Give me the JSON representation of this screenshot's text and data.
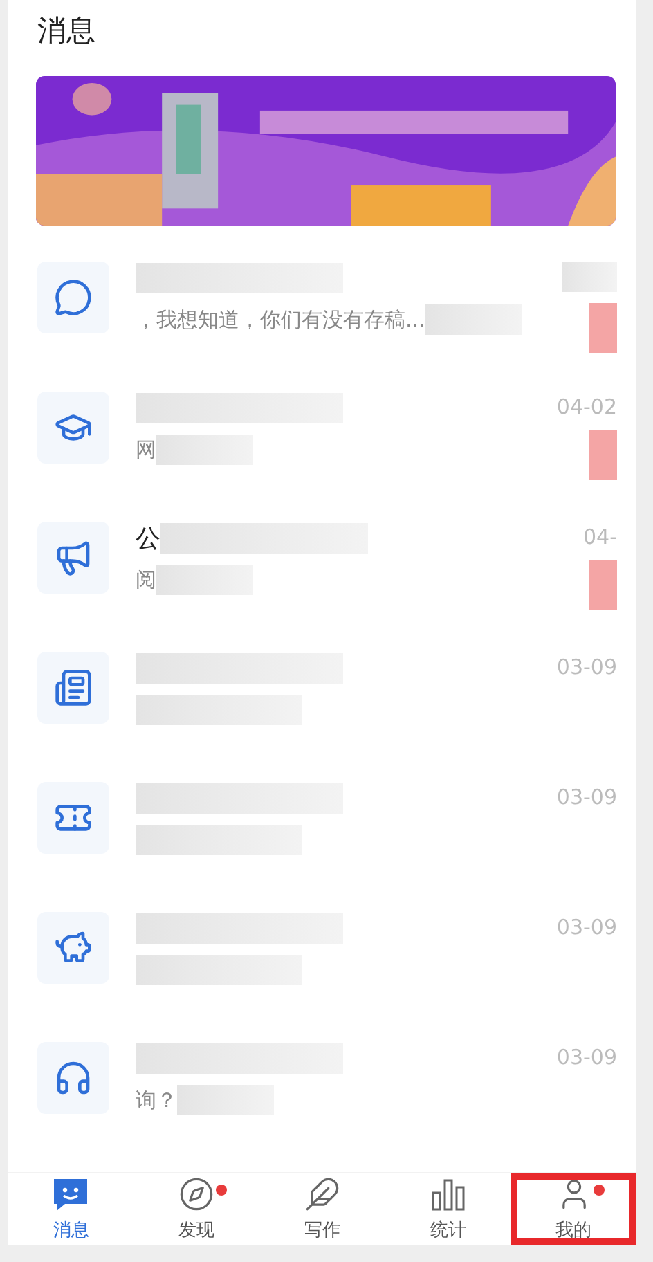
{
  "title": "消息",
  "messages": [
    {
      "preview": "，我想知道，你们有没有存稿..."
    },
    {
      "preview": "网",
      "date": "04-02"
    },
    {
      "title": "公",
      "preview": "阅",
      "date": "04-"
    },
    {
      "date": "03-09"
    },
    {
      "date": "03-09"
    },
    {
      "date": "03-09"
    },
    {
      "preview": "询？",
      "date": "03-09"
    }
  ],
  "tabs": [
    {
      "label": "消息",
      "selected": true,
      "badge": false,
      "highlighted": false
    },
    {
      "label": "发现",
      "selected": false,
      "badge": true,
      "highlighted": false
    },
    {
      "label": "写作",
      "selected": false,
      "badge": false,
      "highlighted": false
    },
    {
      "label": "统计",
      "selected": false,
      "badge": false,
      "highlighted": false
    },
    {
      "label": "我的",
      "selected": false,
      "badge": true,
      "highlighted": true
    }
  ]
}
